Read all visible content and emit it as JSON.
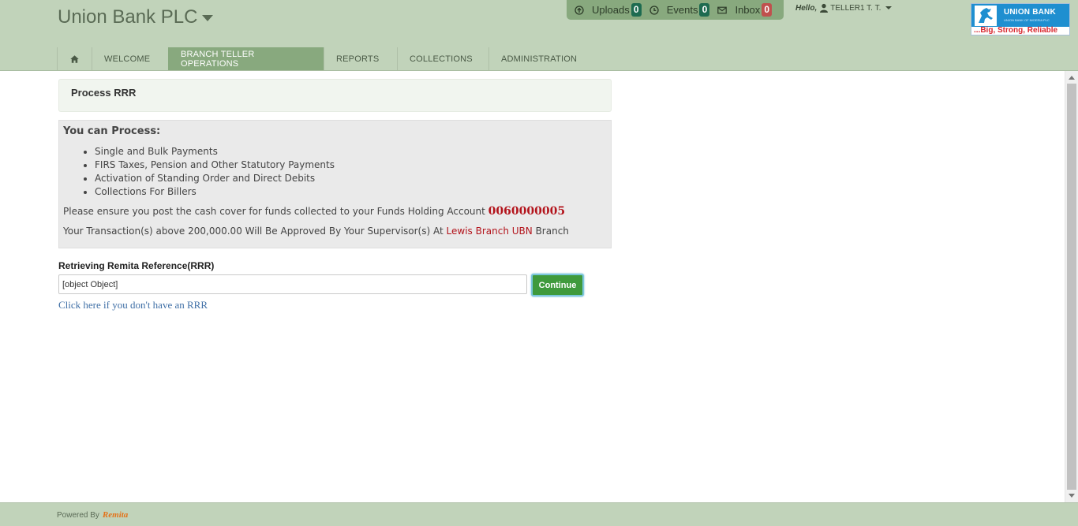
{
  "header": {
    "brand": "Union Bank PLC",
    "notifications": [
      {
        "label": "Uploads",
        "count": "0",
        "badge": "green",
        "icon": "upload-icon"
      },
      {
        "label": "Events",
        "count": "0",
        "badge": "green",
        "icon": "clock-icon"
      },
      {
        "label": "Inbox",
        "count": "0",
        "badge": "red",
        "icon": "envelope-icon"
      }
    ],
    "greeting": "Hello,",
    "user": "TELLER1 T. T.",
    "logo": {
      "name": "UNION BANK",
      "subtitle": "UNION BANK OF NIGERIA PLC",
      "tagline": "...Big, Strong, Reliable"
    }
  },
  "nav": {
    "home_icon": "home-icon",
    "tabs": [
      {
        "label": "WELCOME",
        "active": false
      },
      {
        "label": "BRANCH TELLER OPERATIONS",
        "active": true
      },
      {
        "label": "REPORTS",
        "active": false
      },
      {
        "label": "COLLECTIONS",
        "active": false
      },
      {
        "label": "ADMINISTRATION",
        "active": false
      }
    ]
  },
  "main": {
    "title": "Process RRR",
    "info": {
      "heading": "You can Process:",
      "items": [
        "Single and Bulk Payments",
        "FIRS Taxes, Pension and Other Statutory Payments",
        "Activation of Standing Order and Direct Debits",
        "Collections For Billers"
      ],
      "cash_cover_text": "Please ensure you post the cash cover for funds collected to your Funds Holding Account",
      "account_number": "0060000005",
      "approval_prefix": "Your Transaction(s) above 200,000.00 Will Be Approved By Your Supervisor(s) At",
      "branch_name": "Lewis Branch UBN",
      "approval_suffix": "Branch"
    },
    "rrr": {
      "label": "Retrieving Remita Reference(RRR)",
      "value": "[object Object]",
      "continue_label": "Continue",
      "no_rrr_link": "Click here if you don't have an RRR"
    }
  },
  "footer": {
    "powered_by": "Powered By",
    "provider": "Remita"
  },
  "colors": {
    "header_bg": "#c1d3ba",
    "active_tab": "#88a97e",
    "continue_button": "#3f9a3c",
    "account_red": "#b3141c",
    "link_blue": "#3f6fa6"
  }
}
